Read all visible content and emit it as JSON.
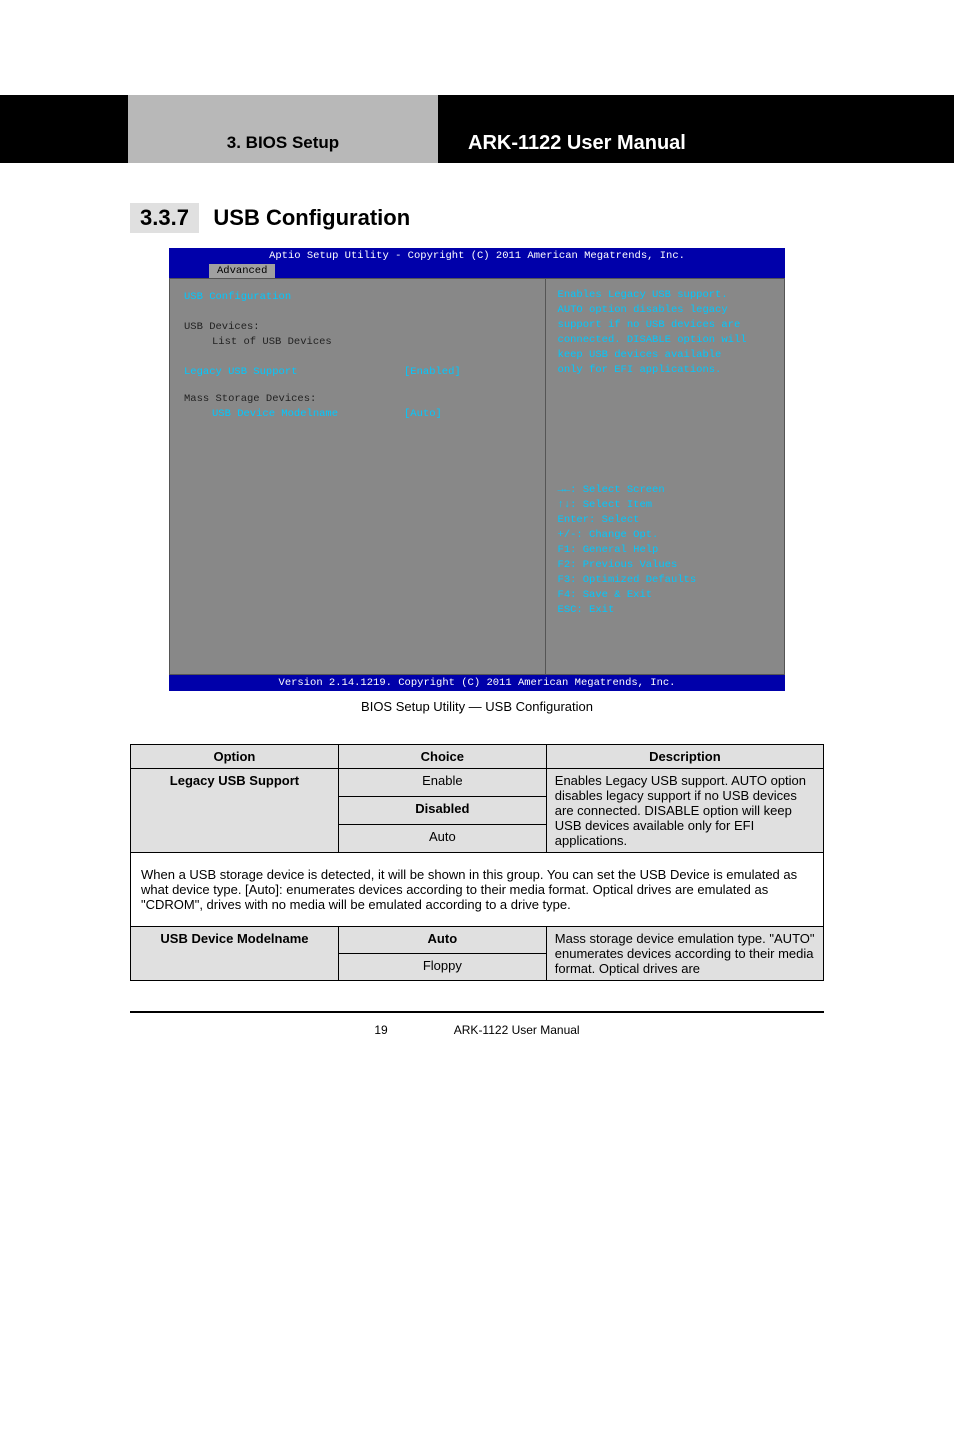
{
  "header": {
    "chapter_band_left": "3. BIOS Setup",
    "chapter_band_right": "ARK-1122 User Manual"
  },
  "section": {
    "number": "3.3.7",
    "title": "USB Configuration"
  },
  "bios": {
    "top": "Aptio Setup Utility - Copyright (C) 2011 American Megatrends, Inc.",
    "tab": "Advanced",
    "left_lines": {
      "l1": "USB Configuration",
      "l2_label": "USB Devices:",
      "l2_value": "List of USB Devices",
      "l3_label": "Legacy USB Support",
      "l3_value": "[Enabled]",
      "l4": "Mass Storage Devices:",
      "l5_label": "USB Device Modelname",
      "l5_value": "[Auto]"
    },
    "help_lines": {
      "h1": "Enables Legacy USB support.",
      "h2": "AUTO option disables legacy",
      "h3": "support if no USB devices are",
      "h4": "connected. DISABLE option will",
      "h5": "keep USB devices available",
      "h6": "only for EFI applications."
    },
    "nav_lines": {
      "n1": "→←: Select Screen",
      "n2": "↑↓: Select Item",
      "n3": "Enter: Select",
      "n4": "+/-: Change Opt.",
      "n5": "F1: General Help",
      "n6": "F2: Previous Values",
      "n7": "F3: Optimized Defaults",
      "n8": "F4: Save & Exit",
      "n9": "ESC: Exit"
    },
    "bottom": "Version 2.14.1219. Copyright (C) 2011 American Megatrends, Inc."
  },
  "caption": "BIOS Setup Utility — USB Configuration",
  "table1": {
    "opt_hdr": "Option",
    "choice_hdr": "Choice",
    "desc_hdr": "Description",
    "r1_opt": "Legacy USB Support",
    "r1_c1": "Enable",
    "r1_c2": "Disabled",
    "r1_c3": "Auto",
    "r1_desc": "Enables Legacy USB support. AUTO option disables legacy support if no USB devices are connected. DISABLE option will keep USB devices available only for EFI applications.",
    "r2_span": "When a USB storage device is detected, it will be shown in this group. You can set the USB Device is emulated as what device type. [Auto]: enumerates devices according to their media format. Optical drives are emulated as \"CDROM\", drives with no media will be emulated according to a drive type.",
    "r3_opt": "USB Device Modelname",
    "r3_c1": "Auto",
    "r3_c2": "Floppy",
    "r3_desc": "Mass storage device emulation type. \"AUTO\" enumerates devices according to their media format. Optical drives are"
  },
  "footer": {
    "page": "19",
    "doc": "ARK-1122 User Manual"
  }
}
